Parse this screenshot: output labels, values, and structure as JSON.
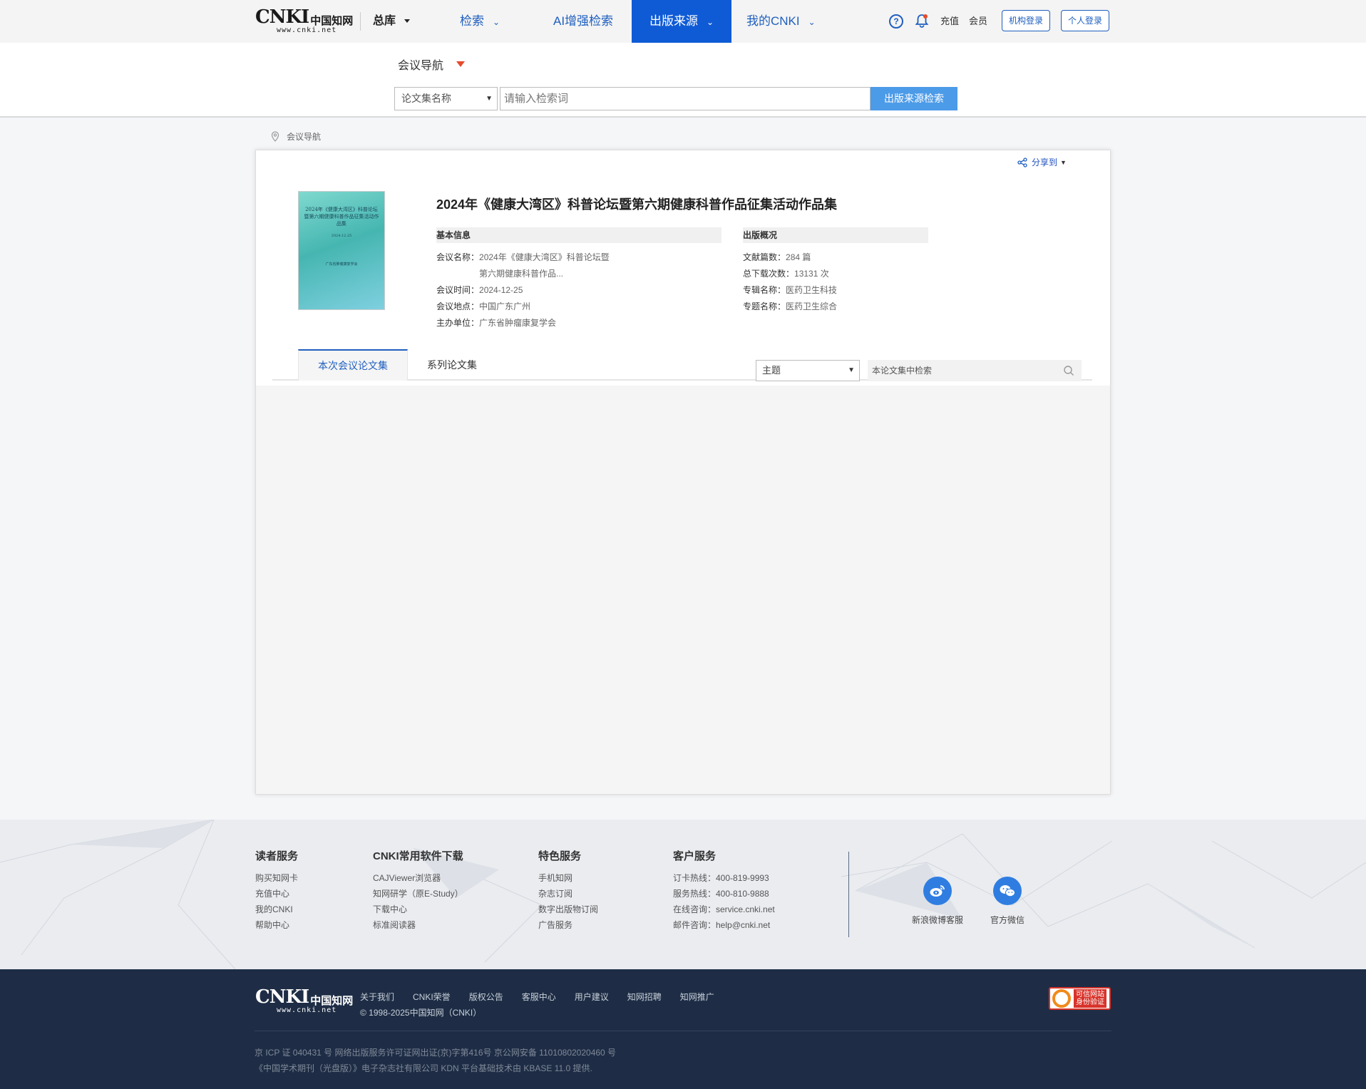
{
  "brand": {
    "mark": "CNKI",
    "cn": "中国知网",
    "url": "www.cnki.net"
  },
  "nav": {
    "library": "总库",
    "search": "检索",
    "ai_search": "AI增强检索",
    "publication_source": "出版来源",
    "my_cnki": "我的CNKI",
    "recharge": "充值",
    "member": "会员",
    "institution_login": "机构登录",
    "personal_login": "个人登录"
  },
  "search_band": {
    "title": "会议导航",
    "field_select": "论文集名称",
    "placeholder": "请输入检索词",
    "button": "出版来源检索"
  },
  "breadcrumb": "会议导航",
  "share": "分享到",
  "proceedings": {
    "cover": {
      "title": "2024年《健康大湾区》科普论坛暨第六期健康科普作品征集活动作品集",
      "date": "2024.12.25",
      "publisher": "广东省肿瘤康复学会"
    },
    "title": "2024年《健康大湾区》科普论坛暨第六期健康科普作品征集活动作品集",
    "basic_info": {
      "heading": "基本信息",
      "name_label": "会议名称：",
      "name_line1": "2024年《健康大湾区》科普论坛暨",
      "name_line2": "第六期健康科普作品...",
      "time_label": "会议时间：",
      "time": "2024-12-25",
      "place_label": "会议地点：",
      "place": "中国广东广州",
      "host_label": "主办单位：",
      "host": "广东省肿瘤康复学会"
    },
    "pub_overview": {
      "heading": "出版概况",
      "docs_label": "文献篇数：",
      "docs": "284 篇",
      "downloads_label": "总下载次数：",
      "downloads": "13131 次",
      "series_label": "专辑名称：",
      "series": "医药卫生科技",
      "topic_label": "专题名称：",
      "topic": "医药卫生综合"
    }
  },
  "tabs": {
    "current": "本次会议论文集",
    "series": "系列论文集",
    "scope_select": "主题",
    "in_search_placeholder": "本论文集中检索"
  },
  "footer": {
    "reader": {
      "heading": "读者服务",
      "items": [
        "购买知网卡",
        "充值中心",
        "我的CNKI",
        "帮助中心"
      ]
    },
    "software": {
      "heading": "CNKI常用软件下载",
      "items": [
        "CAJViewer浏览器",
        "知网研学（原E-Study）",
        "下载中心",
        "标准阅读器"
      ]
    },
    "special": {
      "heading": "特色服务",
      "items": [
        "手机知网",
        "杂志订阅",
        "数字出版物订阅",
        "广告服务"
      ]
    },
    "customer": {
      "heading": "客户服务",
      "items": [
        "订卡热线：400-819-9993",
        "服务热线：400-810-9888",
        "在线咨询：service.cnki.net",
        "邮件咨询：help@cnki.net"
      ]
    },
    "weibo": "新浪微博客服",
    "wechat": "官方微信"
  },
  "bottom": {
    "links": [
      "关于我们",
      "CNKI荣誉",
      "版权公告",
      "客服中心",
      "用户建议",
      "知网招聘",
      "知网推广"
    ],
    "copyright": "© 1998-2025中国知网（CNKI）",
    "legal1": "京 ICP 证 040431 号  网络出版服务许可证网出证(京)字第416号  京公网安备 11010802020460 号",
    "legal2": "《中国学术期刊（光盘版）》电子杂志社有限公司  KDN 平台基础技术由 KBASE 11.0 提供.",
    "trust_badge": "可信网站 身份验证"
  },
  "colors": {
    "nav_active": "#0f5bd6",
    "accent": "#1f5fbf",
    "search_btn": "#4c9be8",
    "footer_dark": "#1e2d45"
  }
}
